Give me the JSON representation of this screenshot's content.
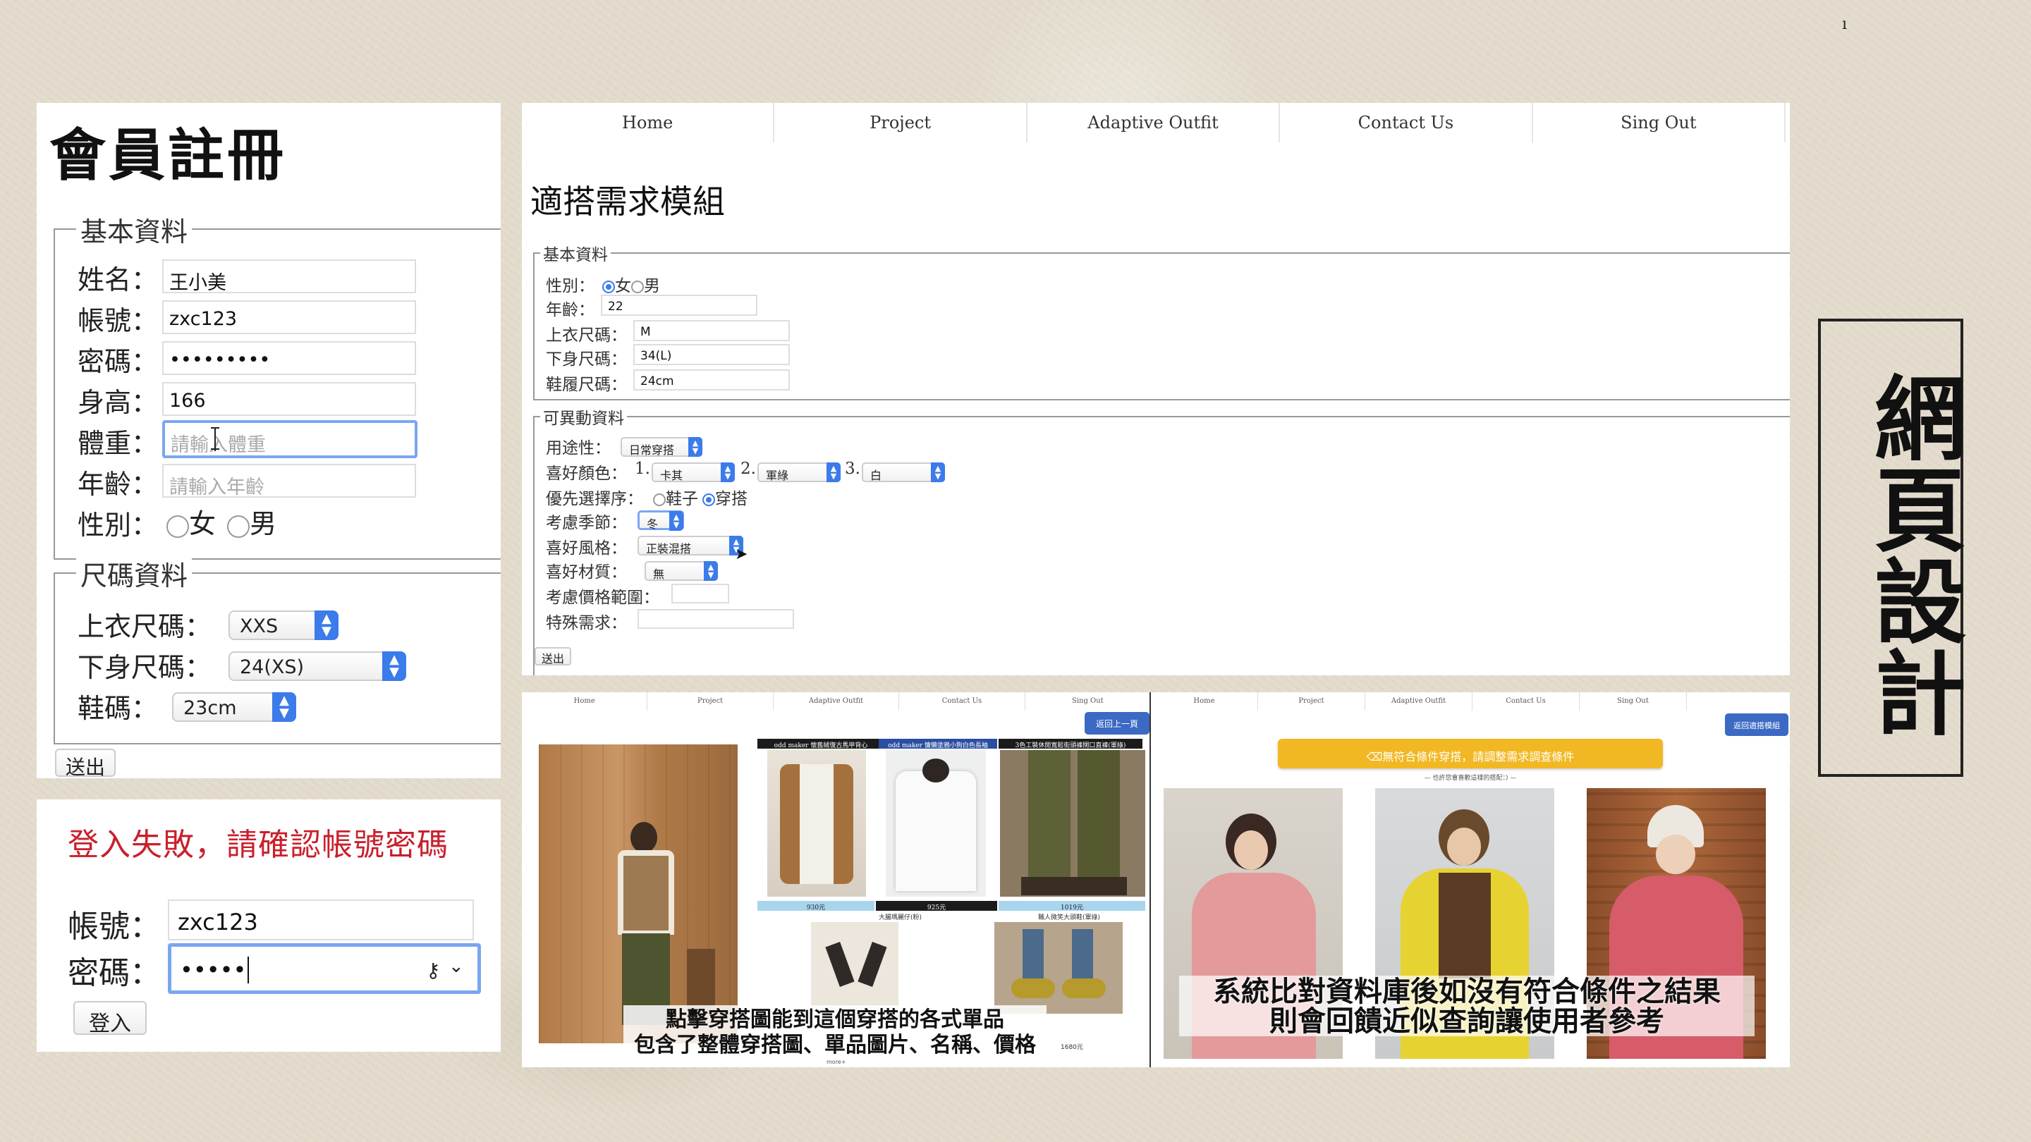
{
  "registration": {
    "title": "會員註冊",
    "basic_legend": "基本資料",
    "fields": [
      {
        "label": "姓名：",
        "value": "王小美"
      },
      {
        "label": "帳號：",
        "value": "zxc123"
      },
      {
        "label": "密碼：",
        "value": "•••••••••"
      },
      {
        "label": "身高：",
        "value": "166"
      },
      {
        "label": "體重：",
        "placeholder": "請輸入體重"
      },
      {
        "label": "年齡：",
        "placeholder": "請輸入年齡"
      }
    ],
    "gender_label": "性別：",
    "gender_options": [
      "女",
      "男"
    ],
    "size_legend": "尺碼資料",
    "sizes": [
      {
        "label": "上衣尺碼：",
        "value": "XXS"
      },
      {
        "label": "下身尺碼：",
        "value": "24(XS)"
      },
      {
        "label": "鞋碼：",
        "value": "23cm"
      }
    ],
    "submit": "送出"
  },
  "login": {
    "error": "登入失敗，請確認帳號密碼",
    "account_label": "帳號：",
    "account_value": "zxc123",
    "password_label": "密碼：",
    "password_value": "•••••",
    "submit": "登入"
  },
  "module": {
    "nav": [
      "Home",
      "Project",
      "Adaptive Outfit",
      "Contact Us",
      "Sing Out"
    ],
    "title": "適搭需求模組",
    "basic_legend": "基本資料",
    "gender_label": "性別：",
    "gender_options": [
      "女",
      "男"
    ],
    "age_label": "年齡：",
    "age_value": "22",
    "top_label": "上衣尺碼：",
    "top_value": "M",
    "bottom_label": "下身尺碼：",
    "bottom_value": "34(L)",
    "shoe_label": "鞋履尺碼：",
    "shoe_value": "24cm",
    "variable_legend": "可異動資料",
    "purpose_label": "用途性：",
    "purpose_value": "日常穿搭",
    "color_label": "喜好顏色：",
    "color_prefixes": [
      "1.",
      "2.",
      "3."
    ],
    "colors": [
      "卡其",
      "軍綠",
      "白"
    ],
    "priority_label": "優先選擇序：",
    "priority_options": [
      "鞋子",
      "穿搭"
    ],
    "season_label": "考慮季節：",
    "season_value": "冬",
    "style_label": "喜好風格：",
    "style_value": "正裝混搭",
    "material_label": "喜好材質：",
    "material_value": "無",
    "price_label": "考慮價格範圍：",
    "special_label": "特殊需求：",
    "submit": "送出"
  },
  "result_left": {
    "nav": [
      "Home",
      "Project",
      "Adaptive Outfit",
      "Contact Us",
      "Sing Out"
    ],
    "back": "返回上一頁",
    "items": [
      {
        "name": "odd maker 懷舊絨復古馬甲背心",
        "price": "930元"
      },
      {
        "name": "odd maker 慵懶塗鴉小狗白色長袖",
        "price": "925元"
      },
      {
        "name": "3色工裝休閒寬鬆街頭褲闊口直褲(軍綠)",
        "price": "1019元"
      }
    ],
    "sub_names": [
      "大腸瑪麗仔(粉)",
      "職人微笑大頭鞋(軍綠)"
    ],
    "sub_price": "1680元",
    "more": "more+",
    "caption_line1": "點擊穿搭圖能到這個穿搭的各式單品",
    "caption_line2": "包含了整體穿搭圖、單品圖片、名稱、價格"
  },
  "result_right": {
    "nav": [
      "Home",
      "Project",
      "Adaptive Outfit",
      "Contact Us",
      "Sing Out"
    ],
    "back": "返回適搭模組",
    "banner": "⌫無符合條件穿搭，請調整需求調查條件",
    "sub": "— 也許您會喜歡這樣的搭配：) —",
    "caption_line1": "系統比對資料庫後如沒有符合條件之結果",
    "caption_line2": "則會回饋近似查詢讓使用者參考"
  },
  "side_title": "網頁設計",
  "corner_mark": "ı",
  "colors": {
    "accent": "#3b7bea",
    "error": "#c8202c",
    "banner": "#f2b824",
    "back_button": "#3b69c4"
  }
}
